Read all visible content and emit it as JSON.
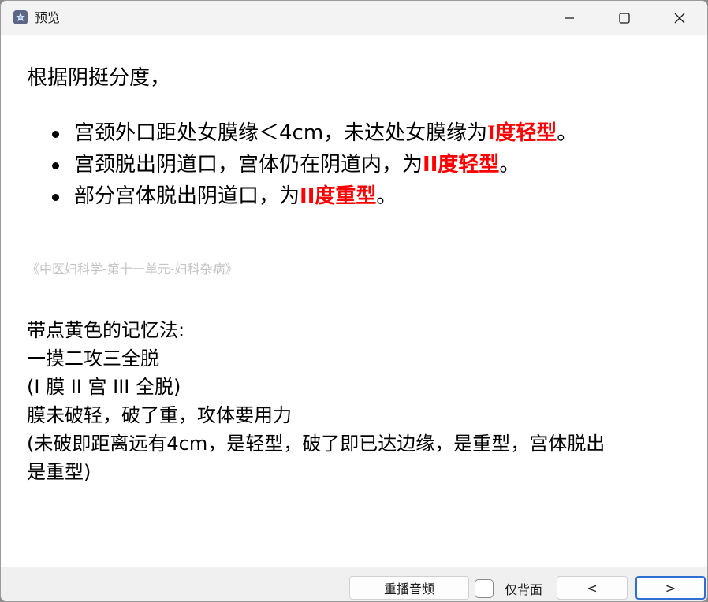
{
  "window": {
    "title": "预览",
    "app_icon": "star-app-icon",
    "controls": [
      "minimize-icon",
      "maximize-icon",
      "close-icon"
    ]
  },
  "content": {
    "heading": "根据阴挺分度，",
    "bullets": [
      {
        "text": "宫颈外口距处女膜缘＜4cm，未达处女膜缘为",
        "highlight": "I度轻型",
        "end": "。"
      },
      {
        "text": "宫颈脱出阴道口，宫体仍在阴道内，为",
        "highlight": "II度轻型",
        "end": "。"
      },
      {
        "text": "部分宫体脱出阴道口，为",
        "highlight": "II度重型",
        "end": "。"
      }
    ],
    "source": "《中医妇科学-第十一单元-妇科杂病》",
    "memo": [
      "带点黄色的记忆法:",
      "一摸二攻三全脱",
      "(I 膜 II 宫 III 全脱)",
      "膜未破轻，破了重，攻体要用力",
      "(未破即距离远有4cm，是轻型，破了即已达边缘，是重型，宫体脱出",
      "是重型)"
    ],
    "highlight_color": "#ff0000",
    "source_color": "#c4c4c4"
  },
  "bottombar": {
    "replay_label": "重播音频",
    "back_only_label": "仅背面",
    "back_only_checked": false,
    "prev_label": "<",
    "next_label": ">",
    "focus_color": "#2f6fd1"
  }
}
